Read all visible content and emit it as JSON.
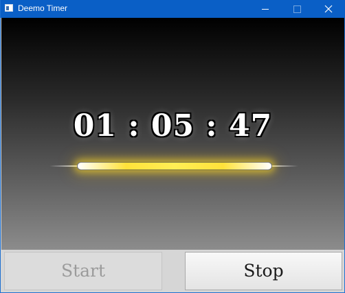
{
  "window": {
    "title": "Deemo Timer",
    "title_bar_color": "#0a5fc6"
  },
  "timer": {
    "display": "01 : 05 : 47",
    "glow_color": "#ffe23a"
  },
  "controls": {
    "start_label": "Start",
    "start_enabled": false,
    "stop_label": "Stop",
    "stop_enabled": true
  },
  "icons": {
    "app": "app-window-icon",
    "minimize": "minimize-icon",
    "maximize": "maximize-icon",
    "close": "close-icon"
  }
}
